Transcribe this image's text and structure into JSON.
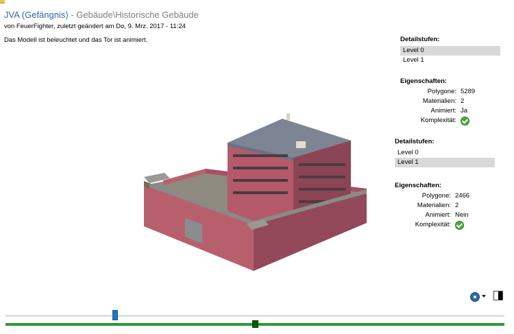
{
  "header": {
    "title": "JVA (Gefängnis)",
    "separator": " - ",
    "category": "Gebäude\\Historische Gebäude",
    "byline": "von FeuerFighter, zuletzt geändert am Do, 9. Mrz. 2017 - 11:24"
  },
  "description": "Das Modell ist beleuchtet und das Tor ist animiert.",
  "model_a": {
    "detail_title": "Detailstufen:",
    "levels": [
      {
        "label": "Level 0",
        "selected": true
      },
      {
        "label": "Level 1",
        "selected": false
      }
    ],
    "props_title": "Eigenschaften:",
    "props": [
      {
        "key": "Polygone:",
        "value": "5289"
      },
      {
        "key": "Materialien:",
        "value": "2"
      },
      {
        "key": "Animiert:",
        "value": "Ja"
      },
      {
        "key": "Komplexität:",
        "value": ""
      }
    ]
  },
  "model_b": {
    "detail_title": "Detailstufen:",
    "levels": [
      {
        "label": "Level 0",
        "selected": false
      },
      {
        "label": "Level 1",
        "selected": true
      }
    ],
    "props_title": "Eigenschaften:",
    "props": [
      {
        "key": "Polygone:",
        "value": "2466"
      },
      {
        "key": "Materialien:",
        "value": "2"
      },
      {
        "key": "Animiert:",
        "value": "Nein"
      },
      {
        "key": "Komplexität:",
        "value": ""
      }
    ]
  },
  "icons": {
    "help": "help-circle-icon",
    "dropdown": "chevron-down-icon",
    "background": "background-toggle-icon",
    "complexity": "check-circle-icon"
  },
  "sliders": {
    "time": {
      "value": 0.22
    },
    "progress": {
      "value": 0.5
    }
  },
  "colors": {
    "title": "#2d6aa6",
    "selected_row": "#d9d9d9",
    "slider_accent": "#1e78c8",
    "track_green": "#2e9a2e",
    "check_green": "#4caa3d"
  }
}
